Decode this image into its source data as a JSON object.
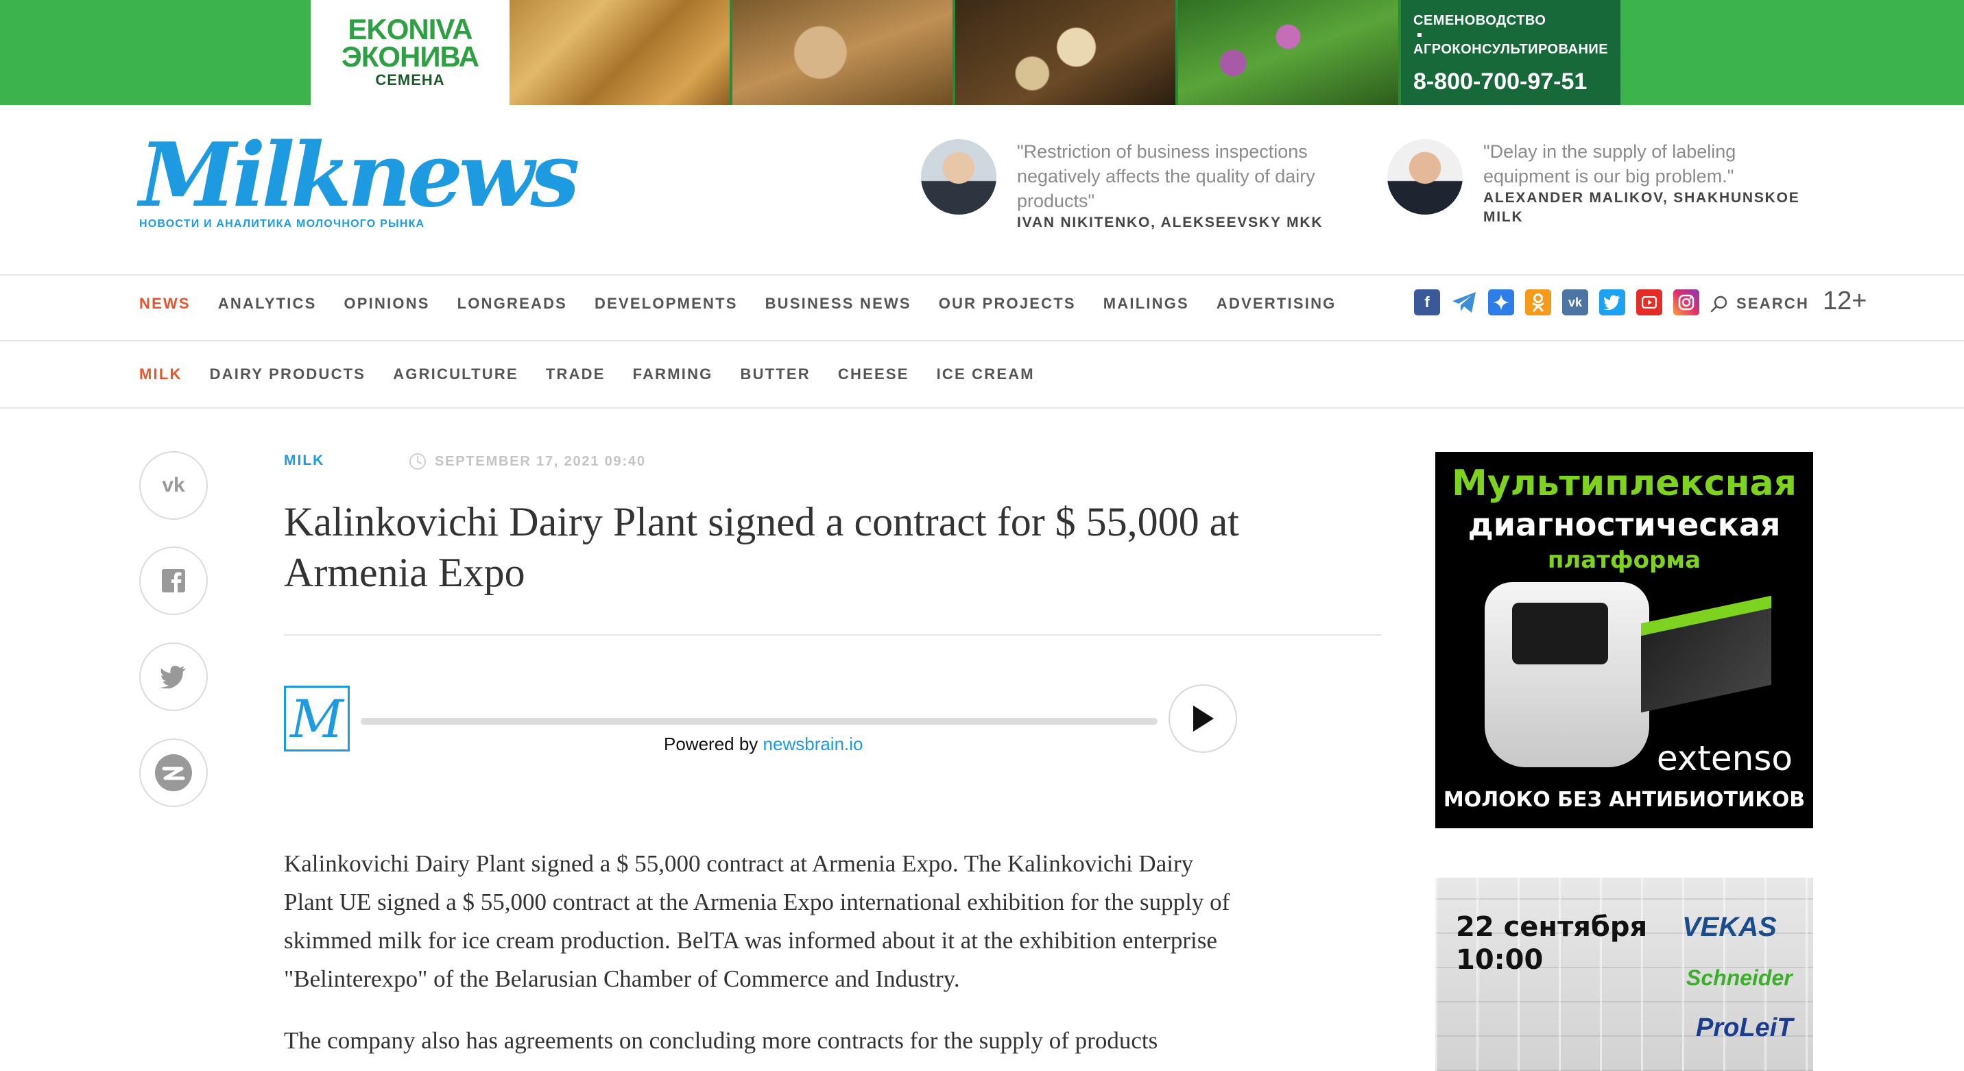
{
  "banner": {
    "logo_line1": "EKONIVA",
    "logo_line2": "ЭКОНИВА",
    "logo_line3": "СЕМЕНА",
    "info_line1": "СЕМЕНОВОДСТВО",
    "info_line2": "АГРОКОНСУЛЬТИРОВАНИЕ",
    "phone": "8-800-700-97-51",
    "color": "#3cb44b"
  },
  "header": {
    "logo_text": "Milknews",
    "logo_tagline": "НОВОСТИ И АНАЛИТИКА МОЛОЧНОГО РЫНКА",
    "quotes": [
      {
        "text": "\"Restriction of business inspections negatively affects the quality of dairy products\"",
        "author": "IVAN NIKITENKO, ALEKSEEVSKY MKK"
      },
      {
        "text": "\"Delay in the supply of labeling equipment is our big problem.\"",
        "author": "ALEXANDER MALIKOV, SHAKHUNSKOE MILK"
      }
    ]
  },
  "nav": {
    "items": [
      "NEWS",
      "ANALYTICS",
      "OPINIONS",
      "LONGREADS",
      "DEVELOPMENTS",
      "BUSINESS NEWS",
      "OUR PROJECTS",
      "MAILINGS",
      "ADVERTISING"
    ],
    "active_color": "#e8552d",
    "search_label": "SEARCH",
    "age_rating": "12+",
    "social_icons": [
      "facebook-icon",
      "telegram-icon",
      "zen-icon",
      "odnoklassniki-icon",
      "vk-icon",
      "twitter-icon",
      "youtube-icon",
      "instagram-icon"
    ]
  },
  "subnav": {
    "items": [
      "MILK",
      "DAIRY PRODUCTS",
      "AGRICULTURE",
      "TRADE",
      "FARMING",
      "BUTTER",
      "CHEESE",
      "ICE CREAM"
    ]
  },
  "article": {
    "category": "MILK",
    "date": "SEPTEMBER 17, 2021 09:40",
    "title": "Kalinkovichi Dairy Plant signed a contract for $ 55,000 at Armenia Expo",
    "player": {
      "logo": "M",
      "powered_prefix": "Powered by ",
      "powered_link": "newsbrain.io"
    },
    "paragraphs": [
      "Kalinkovichi Dairy Plant signed a $ 55,000 contract at Armenia Expo. The Kalinkovichi Dairy Plant UE signed a $ 55,000 contract at the Armenia Expo international exhibition for the supply of skimmed milk for ice cream production. BelTA was informed about it at the exhibition enterprise \"Belinterexpo\" of the Belarusian Chamber of Commerce and Industry.",
      "The company also has agreements on concluding more contracts for the supply of products"
    ]
  },
  "ads": {
    "ad1": {
      "line1": "Мультиплексная",
      "line2": "диагностическая",
      "line3": "платформа",
      "brand": "extenso",
      "footer": "МОЛОКО БЕЗ АНТИБИОТИКОВ"
    },
    "ad2": {
      "date": "22 сентября",
      "time": "10:00",
      "brand1": "VEKAS",
      "brand2": "Schneider",
      "brand3": "ProLeiT"
    }
  }
}
